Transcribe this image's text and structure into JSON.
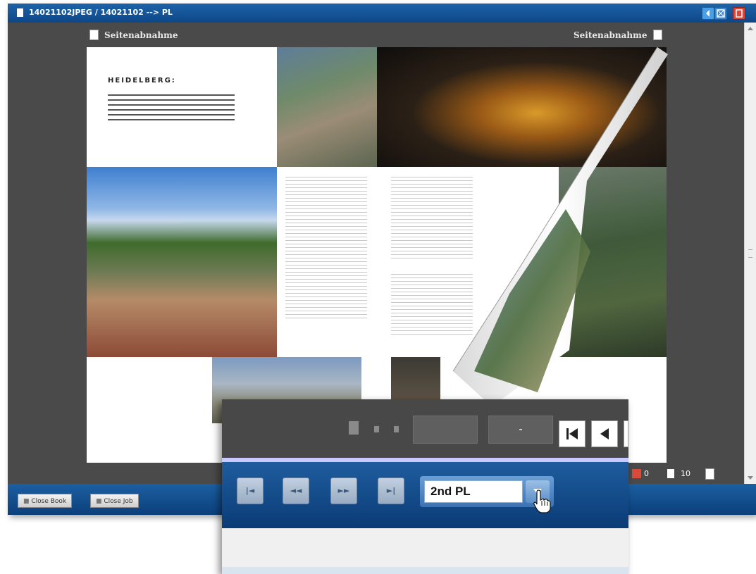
{
  "window": {
    "title": "14021102JPEG / 14021102 --> PL"
  },
  "viewer": {
    "left_page_label": "Seitenabnahme",
    "right_page_label": "Seitenabnahme",
    "page_heading": "HEIDELBERG:",
    "counter_a": "0",
    "counter_b": "10"
  },
  "footer": {
    "close_book": "Close Book",
    "close_job": "Close Job"
  },
  "zoom": {
    "dash": "-",
    "select_value": "2nd PL",
    "nav_buttons": [
      "|◄",
      "◄◄",
      "►►",
      "►|"
    ]
  },
  "colors": {
    "title_bar": "#1a5ea5",
    "viewer_bg": "#4a4a4a",
    "footer_bar": "#0b3f7a",
    "select_bg": "#ffffff",
    "accent_blue": "#3b73b3"
  },
  "icons": {
    "doc": "document-icon",
    "back": "first-page-icon",
    "prev": "previous-icon",
    "cursor": "hand-pointer-icon"
  }
}
